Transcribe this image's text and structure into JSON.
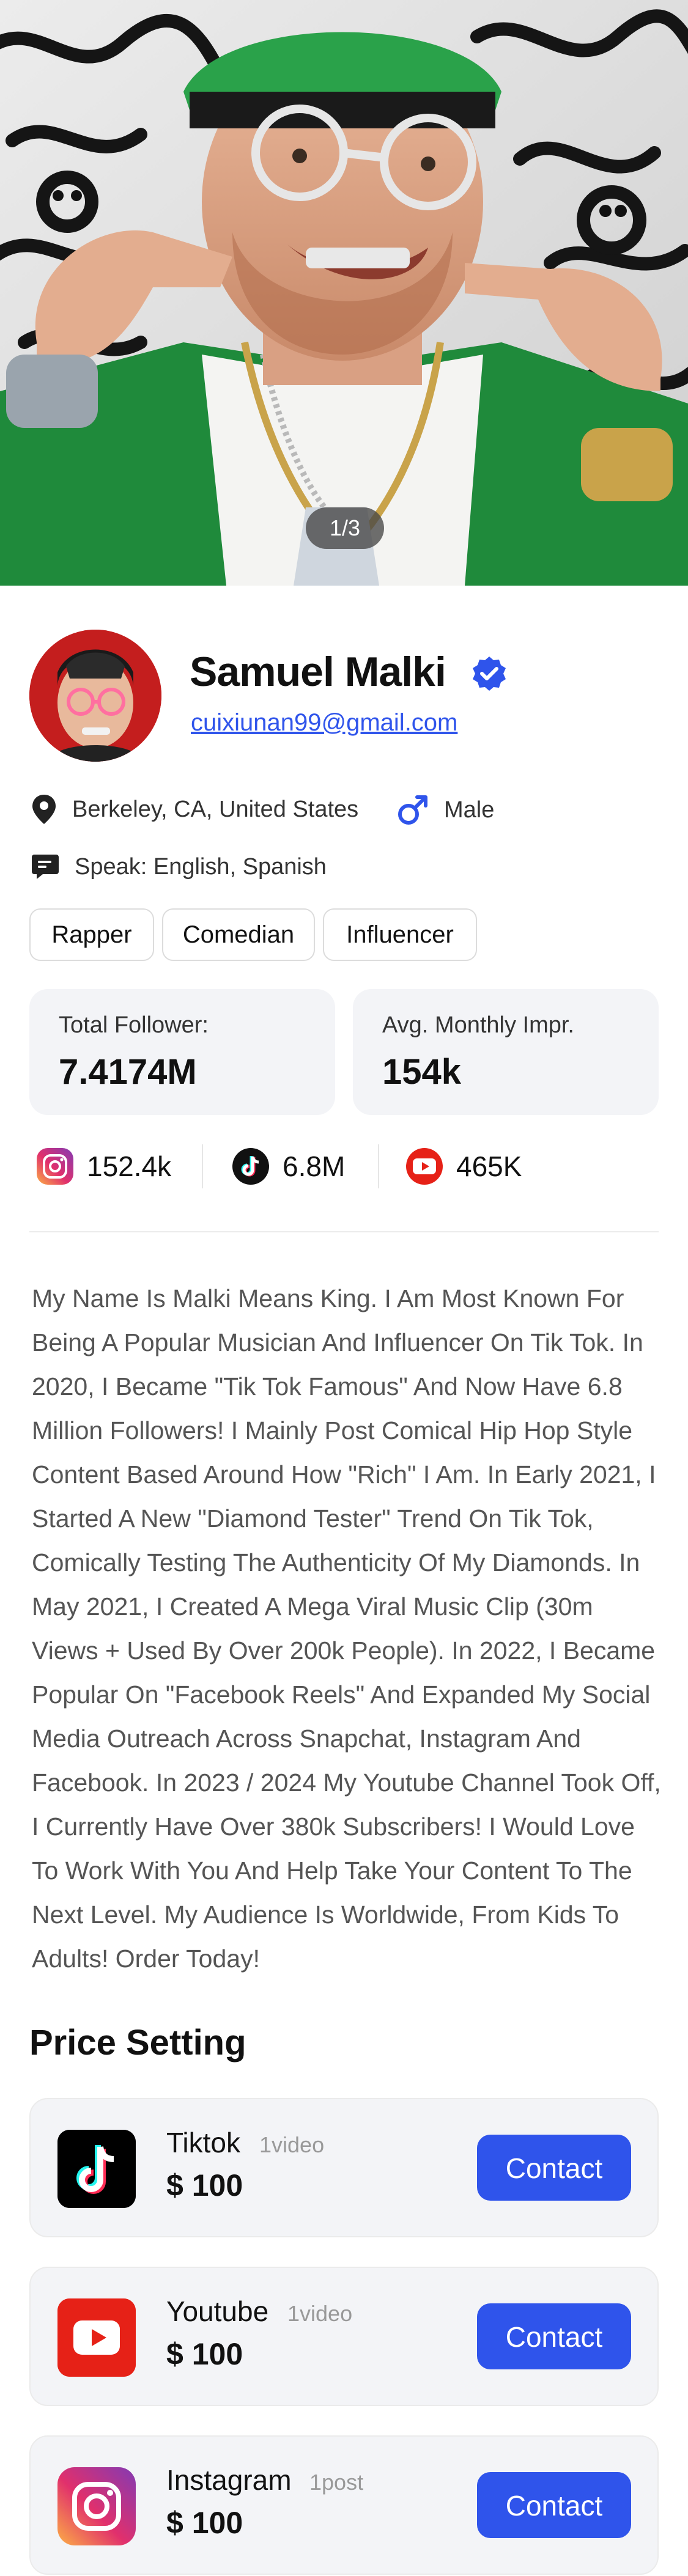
{
  "gallery": {
    "counter": "1/3"
  },
  "profile": {
    "name": "Samuel Malki",
    "email": "cuixiunan99@gmail.com",
    "location": "Berkeley, CA, United States",
    "gender": "Male",
    "languages": "Speak:  English, Spanish",
    "tags": [
      "Rapper",
      "Comedian",
      "Influencer"
    ]
  },
  "stats": [
    {
      "label": "Total Follower:",
      "value": "7.4174M"
    },
    {
      "label": "Avg. Monthly Impr.",
      "value": "154k"
    }
  ],
  "socials": [
    {
      "icon": "instagram-icon",
      "count": "152.4k"
    },
    {
      "icon": "tiktok-icon",
      "count": "6.8M"
    },
    {
      "icon": "youtube-icon",
      "count": "465K"
    }
  ],
  "bio": "My Name Is Malki Means King. I Am Most Known For Being A Popular Musician And Influencer On Tik Tok. In 2020, I Became \"Tik Tok Famous\" And Now Have 6.8 Million Followers! I Mainly Post Comical Hip Hop Style Content Based Around How \"Rich\" I Am. In Early 2021, I Started A New \"Diamond Tester\" Trend On Tik Tok, Comically Testing The Authenticity Of My Diamonds. In May 2021, I Created A Mega Viral Music Clip (30m Views + Used By Over 200k People). In 2022, I Became Popular On \"Facebook Reels\" And Expanded My Social Media Outreach Across Snapchat, Instagram And Facebook. In 2023 / 2024 My Youtube Channel Took Off, I Currently Have Over 380k Subscribers! I Would Love To Work With You And Help Take Your Content To The Next Level. My Audience Is Worldwide, From Kids To Adults! Order Today!",
  "pricing": {
    "title": "Price Setting",
    "items": [
      {
        "platform": "Tiktok",
        "unit": "1video",
        "price": "$ 100",
        "button": "Contact",
        "icon": "tiktok-icon"
      },
      {
        "platform": "Youtube",
        "unit": "1video",
        "price": "$ 100",
        "button": "Contact",
        "icon": "youtube-icon"
      },
      {
        "platform": "Instagram",
        "unit": "1post",
        "price": "$ 100",
        "button": "Contact",
        "icon": "instagram-icon"
      }
    ]
  },
  "colors": {
    "accent": "#2f54eb",
    "card": "#f3f4f7",
    "verified": "#2f54eb"
  }
}
